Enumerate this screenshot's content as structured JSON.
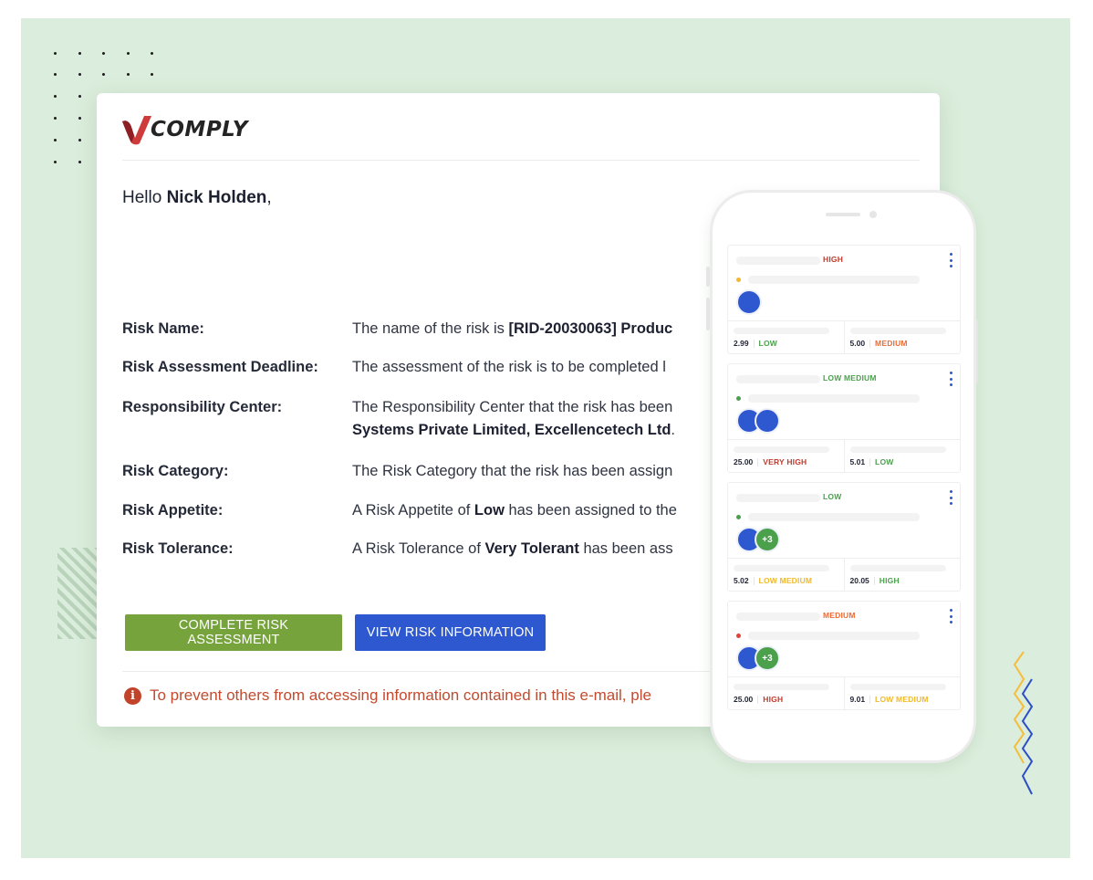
{
  "brand": {
    "logo_text": "COMPLY"
  },
  "email": {
    "greeting_prefix": "Hello ",
    "recipient_name": "Nick Holden",
    "greeting_suffix": ",",
    "rows": [
      {
        "label": "Risk Name:",
        "value_pre": "The name of the risk is ",
        "value_bold": "[RID-20030063] Produc",
        "value_post": ""
      },
      {
        "label": "Risk Assessment Deadline:",
        "value_pre": "The assessment of the risk is to be completed l",
        "value_bold": "",
        "value_post": ""
      },
      {
        "label": "Responsibility Center:",
        "value_pre": "The Responsibility Center that the risk has been",
        "value_line2_bold": "Systems Private Limited, Excellencetech Ltd",
        "value_line2_post": "."
      },
      {
        "label": "Risk Category:",
        "value_pre": "The Risk Category that the risk has been assign",
        "value_bold": "",
        "value_post": ""
      },
      {
        "label": "Risk Appetite:",
        "value_pre": "A Risk Appetite of ",
        "value_bold": "Low",
        "value_post": " has been assigned to the"
      },
      {
        "label": "Risk Tolerance:",
        "value_pre": "A Risk Tolerance of ",
        "value_bold": "Very Tolerant",
        "value_post": " has been ass"
      }
    ],
    "buttons": {
      "complete": "COMPLETE RISK ASSESSMENT",
      "view": "VIEW RISK INFORMATION"
    },
    "warning": "To prevent others from accessing information contained in this e-mail, ple"
  },
  "colors": {
    "background": "#dbeddc",
    "complete_button": "#76a33b",
    "view_button": "#2d58cf",
    "warning": "#c24a2e",
    "high": "#c0392b",
    "medium": "#ec6a34",
    "low": "#4ba04c",
    "low_medium": "#f0b92e"
  },
  "phone": {
    "cards": [
      {
        "badge": "HIGH",
        "badge_color": "#c0392b",
        "dot_color": "#f0b92e",
        "avatars": [
          ""
        ],
        "metrics": [
          {
            "value": "2.99",
            "level": "LOW",
            "color": "#4ba04c"
          },
          {
            "value": "5.00",
            "level": "MEDIUM",
            "color": "#ec6a34"
          }
        ]
      },
      {
        "badge": "LOW MEDIUM",
        "badge_color": "#4ba04c",
        "dot_color": "#4ba04c",
        "avatars": [
          "",
          ""
        ],
        "metrics": [
          {
            "value": "25.00",
            "level": "VERY HIGH",
            "color": "#c0392b"
          },
          {
            "value": "5.01",
            "level": "LOW",
            "color": "#4ba04c"
          }
        ]
      },
      {
        "badge": "LOW",
        "badge_color": "#4ba04c",
        "dot_color": "#4ba04c",
        "avatars": [
          "",
          "+3"
        ],
        "metrics": [
          {
            "value": "5.02",
            "level": "LOW MEDIUM",
            "color": "#f0b92e"
          },
          {
            "value": "20.05",
            "level": "HIGH",
            "color": "#4ba04c"
          }
        ]
      },
      {
        "badge": "MEDIUM",
        "badge_color": "#ec6a34",
        "dot_color": "#e0413a",
        "avatars": [
          "",
          "+3"
        ],
        "metrics": [
          {
            "value": "25.00",
            "level": "HIGH",
            "color": "#c0392b"
          },
          {
            "value": "9.01",
            "level": "LOW MEDIUM",
            "color": "#f0b92e"
          }
        ]
      }
    ]
  }
}
